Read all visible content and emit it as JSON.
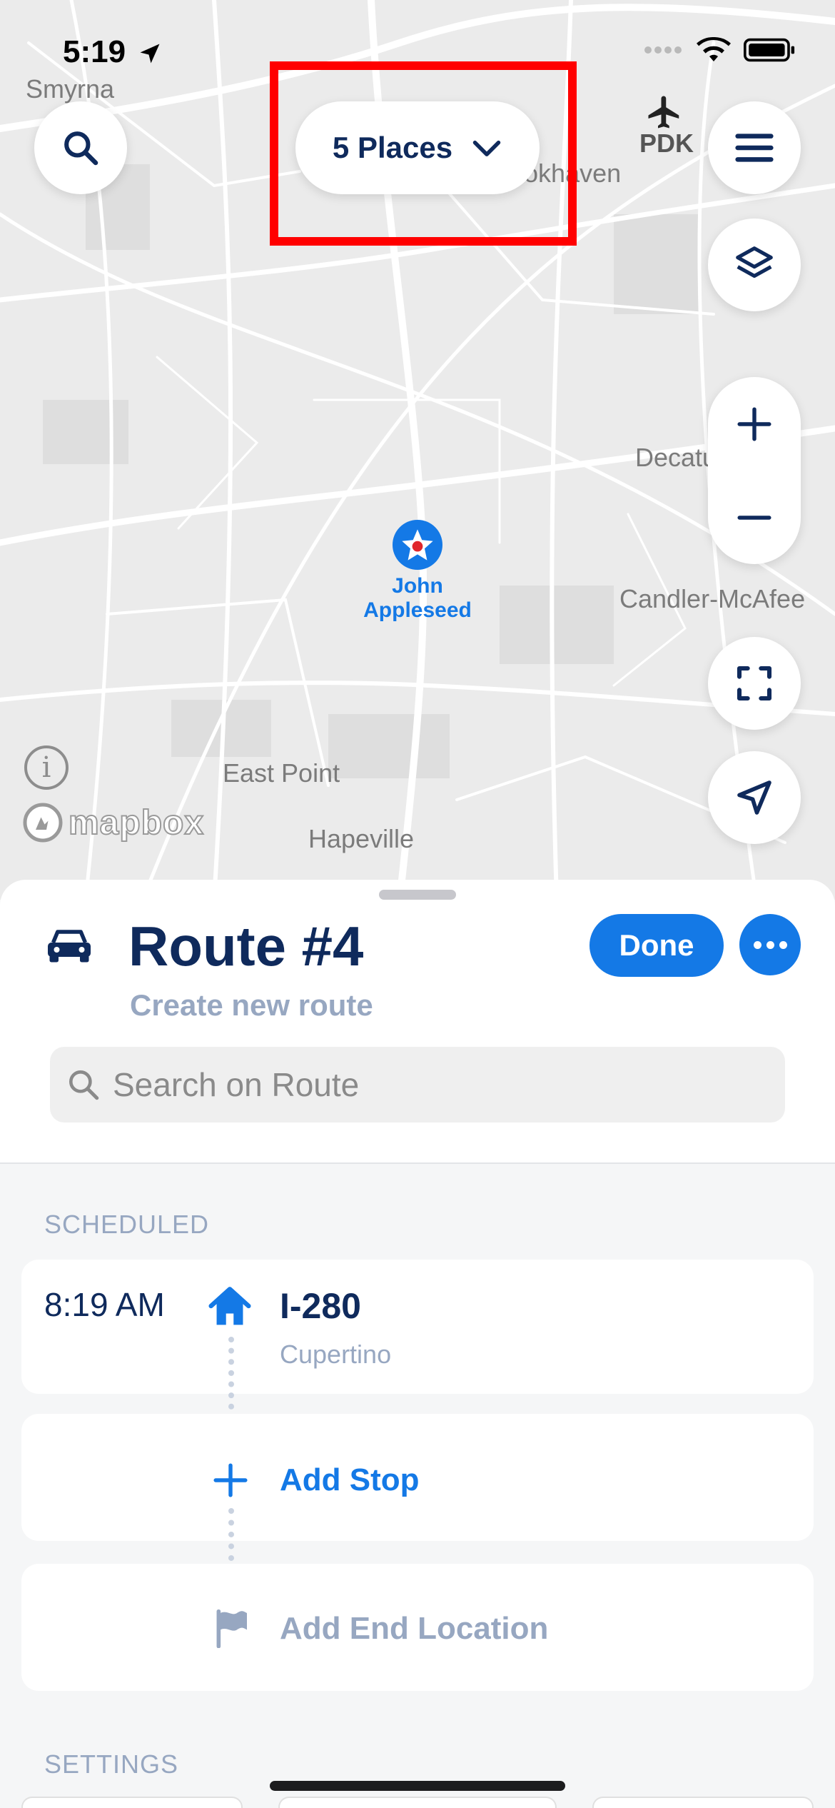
{
  "status_bar": {
    "time": "5:19"
  },
  "map": {
    "labels": {
      "smyrna": "Smyrna",
      "pdk": "PDK",
      "brookhaven": "ookhaven",
      "decatur": "Decatu",
      "candler": "Candler-McAfee",
      "east_point": "East Point",
      "hapeville": "Hapeville"
    },
    "places_button_label": "5 Places",
    "pin_label": "John Appleseed",
    "attribution": "mapbox",
    "info_glyph": "i"
  },
  "sheet": {
    "title": "Route #4",
    "subtitle": "Create new route",
    "done_label": "Done",
    "search_placeholder": "Search on Route"
  },
  "sections": {
    "scheduled": "SCHEDULED",
    "settings": "SETTINGS"
  },
  "stops": [
    {
      "time": "8:19 AM",
      "name": "I-280",
      "city": "Cupertino"
    }
  ],
  "actions": {
    "add_stop": "Add Stop",
    "add_end_location": "Add End Location"
  },
  "colors": {
    "accent": "#1479e6",
    "navy": "#0f2a5c",
    "muted": "#97a7c1",
    "highlight": "#ff0000"
  }
}
